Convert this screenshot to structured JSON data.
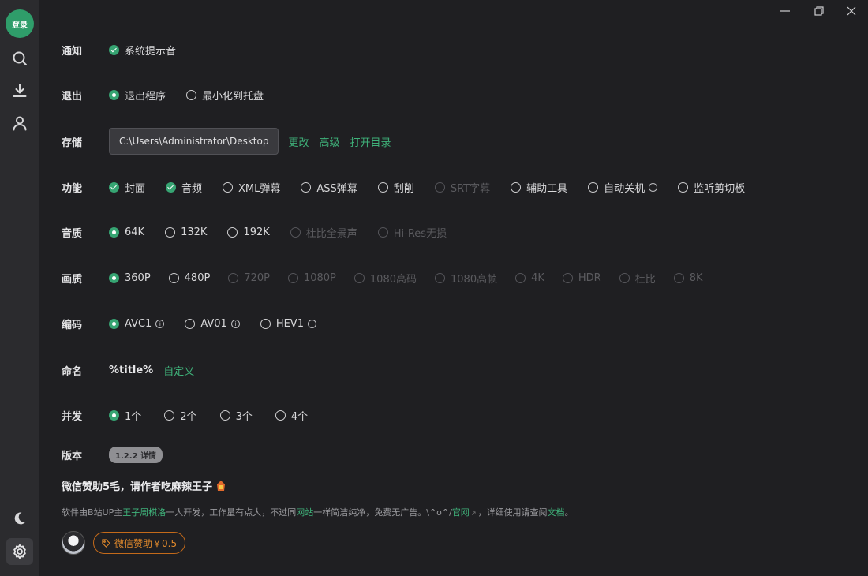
{
  "sidebar": {
    "login_label": "登录",
    "icons": [
      "search-icon",
      "download-icon",
      "user-icon",
      "moon-icon",
      "gear-icon"
    ]
  },
  "window": {
    "controls": [
      "minimize-icon",
      "restore-icon",
      "close-icon"
    ]
  },
  "settings": {
    "notify": {
      "label": "通知",
      "options": [
        {
          "label": "系统提示音",
          "checked": true
        }
      ]
    },
    "exit": {
      "label": "退出",
      "options": [
        {
          "label": "退出程序",
          "checked": true
        },
        {
          "label": "最小化到托盘",
          "checked": false
        }
      ]
    },
    "storage": {
      "label": "存储",
      "path": "C:\\Users\\Administrator\\Desktop",
      "links": [
        "更改",
        "高级",
        "打开目录"
      ]
    },
    "features": {
      "label": "功能",
      "options": [
        {
          "label": "封面",
          "type": "check",
          "checked": true
        },
        {
          "label": "音频",
          "type": "check",
          "checked": true
        },
        {
          "label": "XML弹幕",
          "checked": false
        },
        {
          "label": "ASS弹幕",
          "checked": false
        },
        {
          "label": "刮削",
          "checked": false
        },
        {
          "label": "SRT字幕",
          "checked": false,
          "disabled": true
        },
        {
          "label": "辅助工具",
          "checked": false
        },
        {
          "label": "自动关机",
          "checked": false,
          "info": true
        },
        {
          "label": "监听剪切板",
          "checked": false
        }
      ]
    },
    "audio": {
      "label": "音质",
      "options": [
        {
          "label": "64K",
          "checked": true
        },
        {
          "label": "132K",
          "checked": false
        },
        {
          "label": "192K",
          "checked": false
        },
        {
          "label": "杜比全景声",
          "checked": false,
          "disabled": true
        },
        {
          "label": "Hi-Res无损",
          "checked": false,
          "disabled": true
        }
      ]
    },
    "video": {
      "label": "画质",
      "options": [
        {
          "label": "360P",
          "checked": true
        },
        {
          "label": "480P",
          "checked": false
        },
        {
          "label": "720P",
          "checked": false,
          "disabled": true
        },
        {
          "label": "1080P",
          "checked": false,
          "disabled": true
        },
        {
          "label": "1080高码",
          "checked": false,
          "disabled": true
        },
        {
          "label": "1080高帧",
          "checked": false,
          "disabled": true
        },
        {
          "label": "4K",
          "checked": false,
          "disabled": true
        },
        {
          "label": "HDR",
          "checked": false,
          "disabled": true
        },
        {
          "label": "杜比",
          "checked": false,
          "disabled": true
        },
        {
          "label": "8K",
          "checked": false,
          "disabled": true
        }
      ]
    },
    "codec": {
      "label": "编码",
      "options": [
        {
          "label": "AVC1",
          "checked": true,
          "info": true
        },
        {
          "label": "AV01",
          "checked": false,
          "info": true
        },
        {
          "label": "HEV1",
          "checked": false,
          "info": true
        }
      ]
    },
    "naming": {
      "label": "命名",
      "value": "%title%",
      "link": "自定义"
    },
    "concurrency": {
      "label": "并发",
      "options": [
        {
          "label": "1个",
          "checked": true
        },
        {
          "label": "2个",
          "checked": false
        },
        {
          "label": "3个",
          "checked": false
        },
        {
          "label": "4个",
          "checked": false
        }
      ]
    },
    "version": {
      "label": "版本",
      "badge": "1.2.2 详情"
    }
  },
  "sponsor": {
    "title": "微信赞助5毛，请作者吃麻辣王子",
    "desc_parts": [
      {
        "text": "软件由B站UP主",
        "hl": false
      },
      {
        "text": "王子周棋洛",
        "hl": true
      },
      {
        "text": "一人开发，工作量有点大，不过同",
        "hl": false
      },
      {
        "text": "网站",
        "hl": true
      },
      {
        "text": "一样简洁纯净，免费无广告。\\^o^/",
        "hl": false
      },
      {
        "text": "官网",
        "hl": true
      },
      {
        "text": "，详细使用请查阅",
        "hl": false
      },
      {
        "text": "文档",
        "hl": true
      },
      {
        "text": "。",
        "hl": false
      }
    ],
    "button_label": "微信赞助￥0.5"
  },
  "colors": {
    "accent": "#36a472",
    "link": "#3fb27a",
    "sponsor": "#e0892c",
    "bg": "#1f1f22",
    "sidebar": "#2b2b2e"
  }
}
